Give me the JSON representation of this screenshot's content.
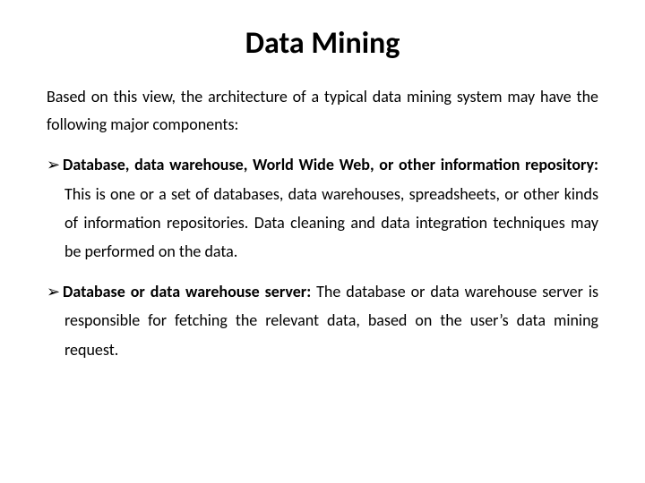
{
  "title": "Data Mining",
  "intro": "Based on this view, the architecture of a typical data mining system may have the following major components:",
  "items": [
    {
      "arrow": "➢ ",
      "heading": "Database, data warehouse, World Wide Web, or other information repository:",
      "body": " This is one or a set of databases, data warehouses, spreadsheets, or other kinds of information repositories. Data cleaning and data integration techniques may be performed on the data."
    },
    {
      "arrow": "➢",
      "heading": "Database or data warehouse server:",
      "body": " The database or data warehouse server is responsible for fetching the relevant data, based on the user’s data mining request."
    }
  ]
}
